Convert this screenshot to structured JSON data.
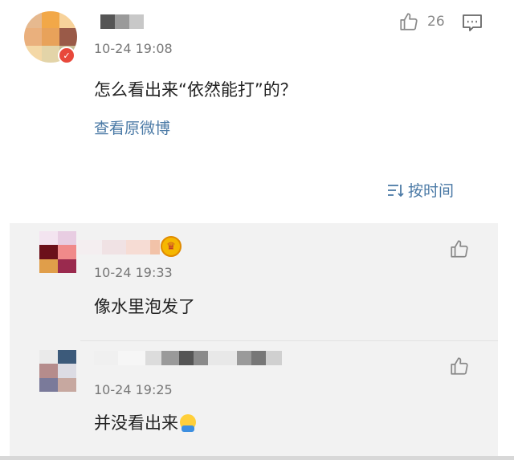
{
  "post": {
    "timestamp": "10-24 19:08",
    "text": "怎么看出来“依然能打”的？",
    "view_original_label": "查看原微博",
    "like_count": "26",
    "sort_label": "按时间"
  },
  "replies": [
    {
      "timestamp": "10-24 19:33",
      "text": "像水里泡发了"
    },
    {
      "timestamp": "10-24 19:25",
      "text": "并没看出来"
    }
  ],
  "icons": {
    "like": "thumbs-up-icon",
    "comment": "comment-icon",
    "sort": "sort-icon",
    "crown": "crown-badge-icon",
    "verified": "verified-badge-icon"
  },
  "colors": {
    "link": "#4b7aa6",
    "reply_background": "#f2f2f2",
    "timestamp": "#777777"
  }
}
